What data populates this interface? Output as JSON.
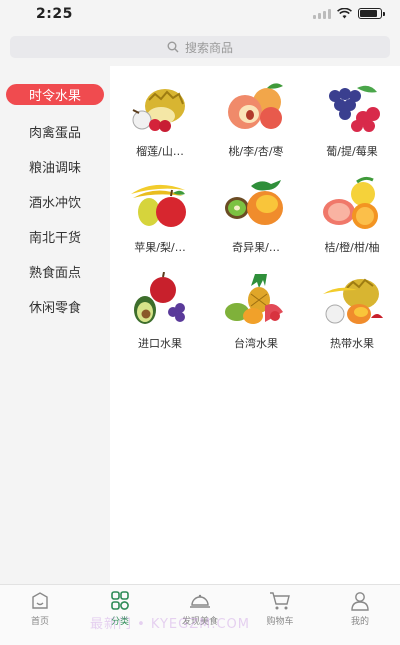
{
  "status_bar": {
    "time": "2:25"
  },
  "search": {
    "placeholder": "搜索商品"
  },
  "categories": [
    {
      "label": "时令水果",
      "active": true
    },
    {
      "label": "肉禽蛋品",
      "active": false
    },
    {
      "label": "粮油调味",
      "active": false
    },
    {
      "label": "酒水冲饮",
      "active": false
    },
    {
      "label": "南北干货",
      "active": false
    },
    {
      "label": "熟食面点",
      "active": false
    },
    {
      "label": "休闲零食",
      "active": false
    }
  ],
  "subcategories": [
    {
      "label": "榴莲/山…",
      "icon": "durian-mangosteen-icon"
    },
    {
      "label": "桃/李/杏/枣",
      "icon": "peach-icon"
    },
    {
      "label": "葡/提/莓果",
      "icon": "grapes-berries-icon"
    },
    {
      "label": "苹果/梨/…",
      "icon": "apple-pear-icon"
    },
    {
      "label": "奇异果/…",
      "icon": "kiwi-mango-icon"
    },
    {
      "label": "桔/橙/柑/柚",
      "icon": "citrus-icon"
    },
    {
      "label": "进口水果",
      "icon": "imported-fruit-icon"
    },
    {
      "label": "台湾水果",
      "icon": "taiwan-fruit-icon"
    },
    {
      "label": "热带水果",
      "icon": "tropical-fruit-icon"
    }
  ],
  "tabbar": [
    {
      "label": "首页",
      "icon": "home-icon",
      "active": false
    },
    {
      "label": "分类",
      "icon": "category-icon",
      "active": true
    },
    {
      "label": "发现美食",
      "icon": "cloche-icon",
      "active": false
    },
    {
      "label": "购物车",
      "icon": "cart-icon",
      "active": false
    },
    {
      "label": "我的",
      "icon": "profile-icon",
      "active": false
    }
  ],
  "watermark": "最新门 • KYEGZM.COM",
  "colors": {
    "accent": "#f04b4f",
    "tab_active": "#2e8b57"
  }
}
